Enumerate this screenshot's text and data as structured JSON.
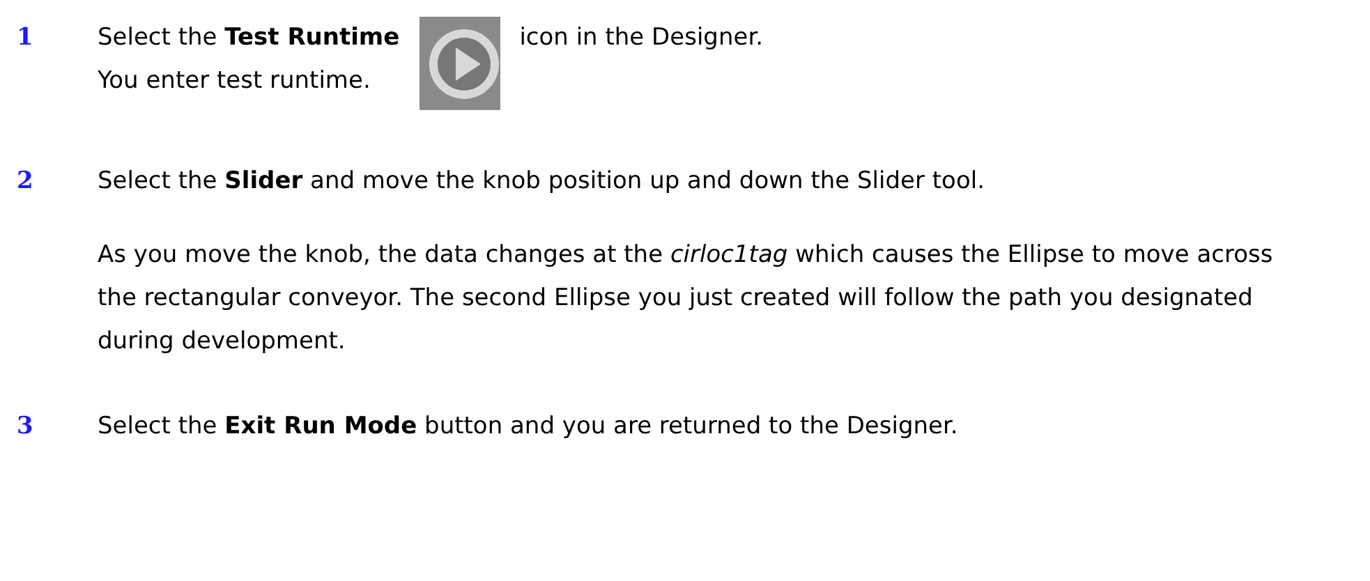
{
  "steps": [
    {
      "number": "1",
      "lines": [
        "Select the **Test Runtime**",
        "You enter test runtime."
      ],
      "trailing": "icon in the Designer.",
      "kind": "with_icon"
    },
    {
      "number": "2",
      "lines": [
        "Select the **Slider** and move the knob position up and down the Slider tool.",
        "As you move the knob, the data changes at the *cirloc1tag* which causes the Ellipse to move across the rectangular conveyor. The second Ellipse you just created will follow the path you designated during development."
      ],
      "kind": "plain"
    },
    {
      "number": "3",
      "lines": [
        "Select the **Exit Run Mode** button and you are returned to the Designer."
      ],
      "kind": "plain"
    }
  ]
}
